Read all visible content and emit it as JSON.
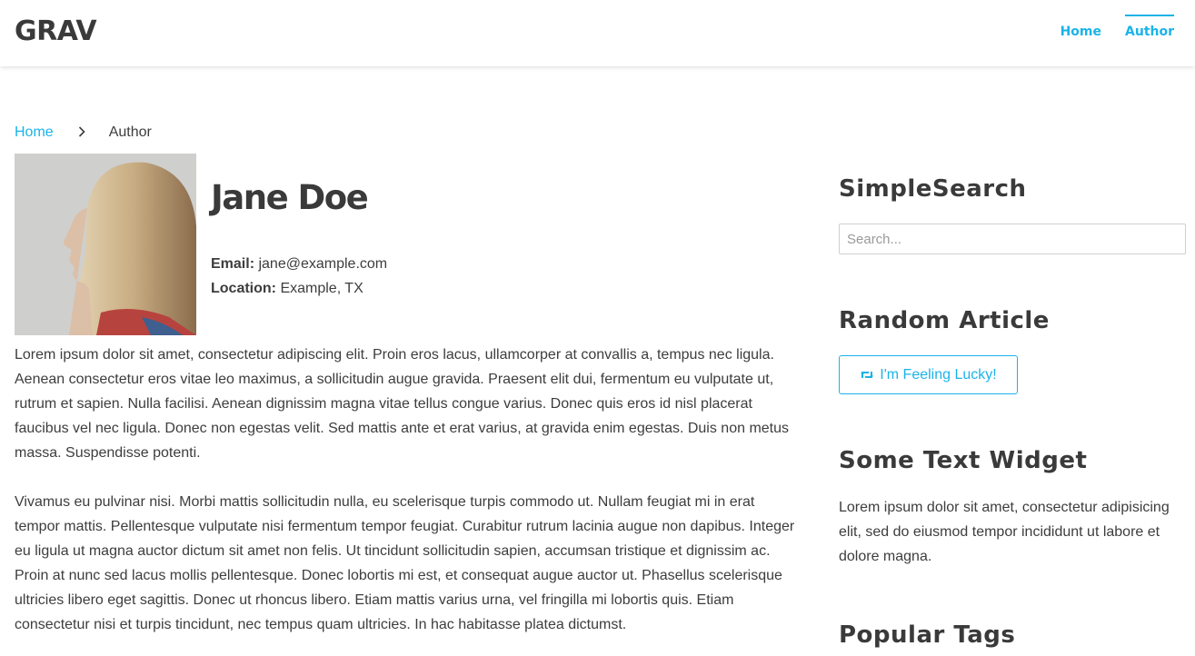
{
  "header": {
    "logo": "GRAV",
    "nav": [
      {
        "label": "Home",
        "active": false
      },
      {
        "label": "Author",
        "active": true
      }
    ],
    "accent_color": "#1bb3e9"
  },
  "breadcrumb": {
    "home": "Home",
    "separator_icon": "chevron-right-icon",
    "current": "Author"
  },
  "author": {
    "name": "Jane Doe",
    "email_label": "Email:",
    "email": "jane@example.com",
    "location_label": "Location:",
    "location": "Example, TX",
    "bio": [
      "Lorem ipsum dolor sit amet, consectetur adipiscing elit. Proin eros lacus, ullamcorper at convallis a, tempus nec ligula. Aenean consectetur eros vitae leo maximus, a sollicitudin augue gravida. Praesent elit dui, fermentum eu vulputate ut, rutrum et sapien. Nulla facilisi. Aenean dignissim magna vitae tellus congue varius. Donec quis eros id nisl placerat faucibus vel nec ligula. Donec non egestas velit. Sed mattis ante et erat varius, at gravida enim egestas. Duis non metus massa. Suspendisse potenti.",
      "Vivamus eu pulvinar nisi. Morbi mattis sollicitudin nulla, eu scelerisque turpis commodo ut. Nullam feugiat mi in erat tempor mattis. Pellentesque vulputate nisi fermentum tempor feugiat. Curabitur rutrum lacinia augue non dapibus. Integer eu ligula ut magna auctor dictum sit amet non felis. Ut tincidunt sollicitudin sapien, accumsan tristique et dignissim ac. Proin at nunc sed lacus mollis pellentesque. Donec lobortis mi est, et consequat augue auctor ut. Phasellus scelerisque ultricies libero eget sagittis. Donec ut rhoncus libero. Etiam mattis varius urna, vel fringilla mi lobortis quis. Etiam consectetur nisi et turpis tincidunt, nec tempus quam ultricies. In hac habitasse platea dictumst."
    ]
  },
  "sidebar": {
    "search": {
      "title": "SimpleSearch",
      "placeholder": "Search..."
    },
    "random": {
      "title": "Random Article",
      "button_label": "I'm Feeling Lucky!",
      "button_icon": "retweet-icon"
    },
    "text_widget": {
      "title": "Some Text Widget",
      "text": "Lorem ipsum dolor sit amet, consectetur adipisicing elit, sed do eiusmod tempor incididunt ut labore et dolore magna."
    },
    "tags": {
      "title": "Popular Tags"
    }
  }
}
